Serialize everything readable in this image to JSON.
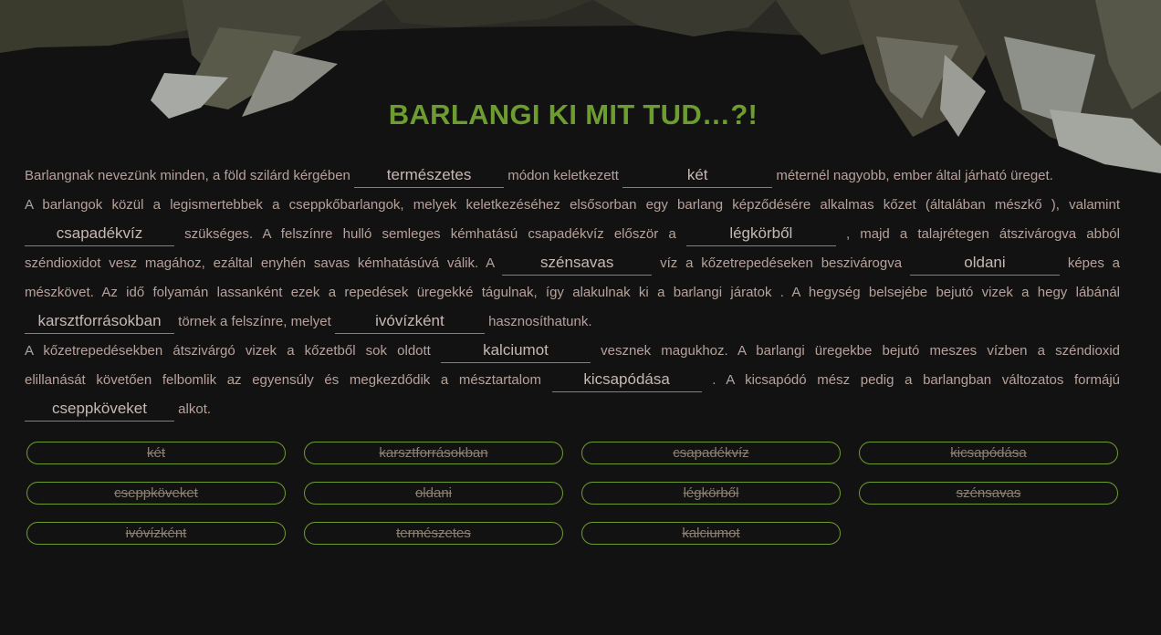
{
  "title": "BARLANGI KI MIT TUD…?!",
  "colors": {
    "accent": "#6d9d30",
    "background": "#131212",
    "text": "#b6a29a",
    "used_word": "#8a8074"
  },
  "decoration": "cave-rock-ceiling",
  "paragraph": {
    "l1": {
      "t1": "Barlangnak nevezünk minden, a föld szilárd kérgében",
      "b1": "természetes",
      "t2": "módon keletkezett",
      "b2": "két",
      "t3": "méternél nagyobb, ember által járható üreget."
    },
    "l2": {
      "t1": "A barlangok közül a legismertebbek a cseppkőbarlangok, melyek keletkezéséhez elsősorban egy barlang képződésére alkalmas kőzet (általában mészkő ), valamint"
    },
    "l3": {
      "b1": "csapadékvíz",
      "t1": "szükséges. A felszínre hulló semleges kémhatású csapadékvíz először a",
      "b2": "légkörből",
      "t2": ", majd a talajrétegen átszivárogva abból"
    },
    "l4": {
      "t1": "széndioxidot vesz magához, ezáltal enyhén savas kémhatásúvá válik. A",
      "b1": "szénsavas",
      "t2": "víz a kőzetrepedéseken beszivárogva",
      "b2": "oldani",
      "t3": "képes a"
    },
    "l5": {
      "t1": "mészkövet. Az idő folyamán lassanként ezek a repedések üregekké tágulnak, így alakulnak ki a barlangi járatok . A hegység belsejébe bejutó vizek a hegy lábánál"
    },
    "l6": {
      "b1": "karsztforrásokban",
      "t1": "törnek a felszínre, melyet",
      "b2": "ivóvízként",
      "t2": "hasznosíthatunk."
    },
    "l7": {
      "t1": "A kőzetrepedésekben átszivárgó vizek a kőzetből sok oldott",
      "b1": "kalciumot",
      "t2": "vesznek magukhoz. A barlangi üregekbe bejutó meszes vízben a széndioxid"
    },
    "l8": {
      "t1": "elillanását követően felbomlik az egyensúly és megkezdődik a mésztartalom",
      "b1": "kicsapódása",
      "t2": ". A kicsapódó mész pedig a barlangban változatos formájú"
    },
    "l9": {
      "b1": "cseppköveket",
      "t1": "alkot."
    }
  },
  "word_bank": [
    "két",
    "karsztforrásokban",
    "csapadékvíz",
    "kicsapódása",
    "cseppköveket",
    "oldani",
    "légkörből",
    "szénsavas",
    "ivóvízként",
    "természetes",
    "kalciumot"
  ]
}
